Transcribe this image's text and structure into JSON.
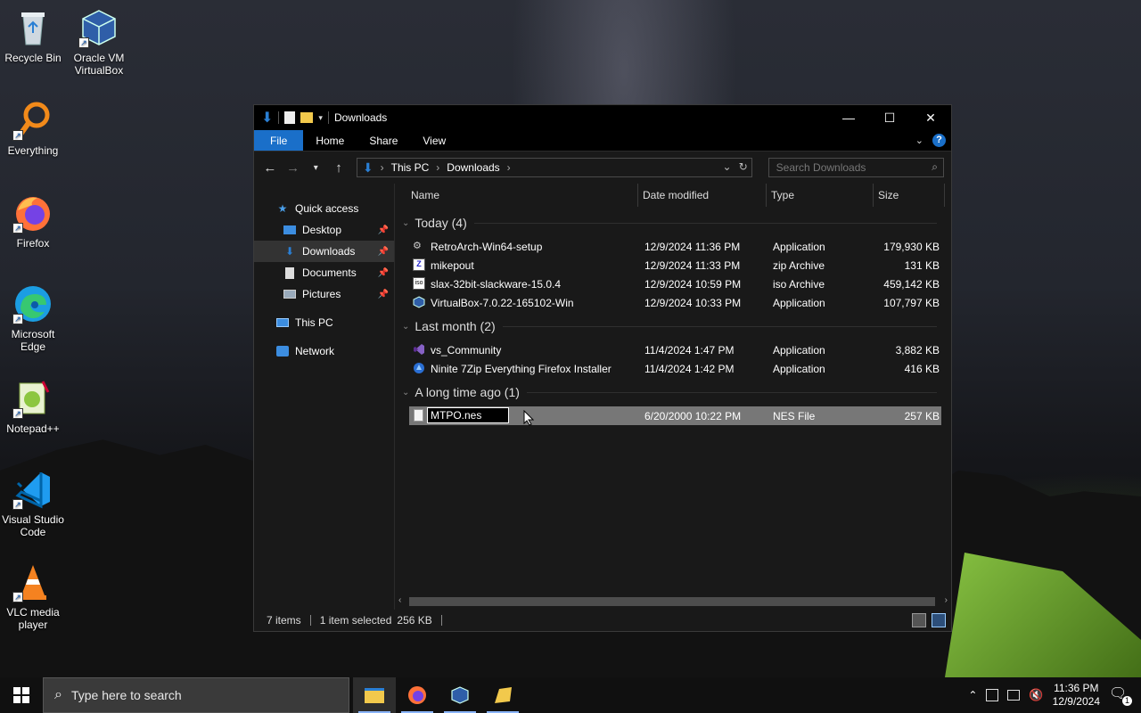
{
  "desktop": {
    "icons": [
      {
        "label": "Recycle Bin"
      },
      {
        "label": "Oracle VM VirtualBox"
      },
      {
        "label": "Everything"
      },
      {
        "label": "Firefox"
      },
      {
        "label": "Microsoft Edge"
      },
      {
        "label": "Notepad++"
      },
      {
        "label": "Visual Studio Code"
      },
      {
        "label": "VLC media player"
      }
    ]
  },
  "window": {
    "title": "Downloads",
    "ribbon": {
      "file": "File",
      "home": "Home",
      "share": "Share",
      "view": "View",
      "help": "?"
    },
    "breadcrumb": [
      "This PC",
      "Downloads"
    ],
    "search_placeholder": "Search Downloads",
    "nav": {
      "quick_access": "Quick access",
      "desktop": "Desktop",
      "downloads": "Downloads",
      "documents": "Documents",
      "pictures": "Pictures",
      "this_pc": "This PC",
      "network": "Network"
    },
    "columns": {
      "name": "Name",
      "date": "Date modified",
      "type": "Type",
      "size": "Size"
    },
    "groups": [
      {
        "label": "Today (4)"
      },
      {
        "label": "Last month (2)"
      },
      {
        "label": "A long time ago (1)"
      }
    ],
    "files": [
      {
        "name": "RetroArch-Win64-setup",
        "date": "12/9/2024 11:36 PM",
        "type": "Application",
        "size": "179,930 KB"
      },
      {
        "name": "mikepout",
        "date": "12/9/2024 11:33 PM",
        "type": "zip Archive",
        "size": "131 KB"
      },
      {
        "name": "slax-32bit-slackware-15.0.4",
        "date": "12/9/2024 10:59 PM",
        "type": "iso Archive",
        "size": "459,142 KB"
      },
      {
        "name": "VirtualBox-7.0.22-165102-Win",
        "date": "12/9/2024 10:33 PM",
        "type": "Application",
        "size": "107,797 KB"
      },
      {
        "name": "vs_Community",
        "date": "11/4/2024 1:47 PM",
        "type": "Application",
        "size": "3,882 KB"
      },
      {
        "name": "Ninite 7Zip Everything Firefox Installer",
        "date": "11/4/2024 1:42 PM",
        "type": "Application",
        "size": "416 KB"
      },
      {
        "name": "MTPO.nes",
        "date": "6/20/2000 10:22 PM",
        "type": "NES File",
        "size": "257 KB"
      }
    ],
    "status": {
      "items": "7 items",
      "selected": "1 item selected",
      "selected_size": "256 KB"
    }
  },
  "taskbar": {
    "search_placeholder": "Type here to search",
    "time": "11:36 PM",
    "date": "12/9/2024",
    "notification_count": "1"
  },
  "colors": {
    "accent": "#1a6fc9",
    "window_bg": "#191919",
    "selected_row": "#777777"
  }
}
